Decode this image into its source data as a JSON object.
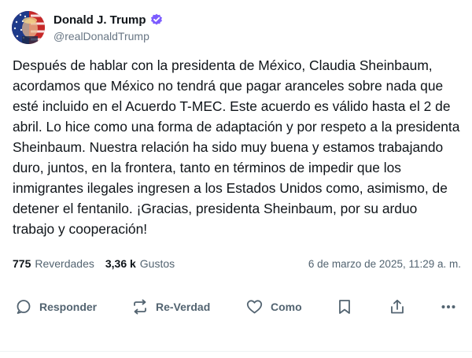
{
  "author": {
    "display_name": "Donald J. Trump",
    "handle": "@realDonaldTrump",
    "verified_badge": "verified-check-icon",
    "badge_color": "#7c5cff"
  },
  "post": {
    "text": "Después de hablar con la presidenta de México, Claudia Sheinbaum, acordamos que México no tendrá que pagar aranceles sobre nada que esté incluido en el Acuerdo T-MEC. Este acuerdo es válido hasta el 2 de abril. Lo hice como una forma de adaptación y por respeto a la presidenta Sheinbaum. Nuestra relación ha sido muy buena y estamos trabajando duro, juntos, en la frontera, tanto en términos de impedir que los inmigrantes ilegales ingresen a los Estados Unidos como, asimismo, de detener el fentanilo. ¡Gracias, presidenta Sheinbaum, por su arduo trabajo y cooperación!"
  },
  "stats": {
    "reposts_count": "775",
    "reposts_label": "Reverdades",
    "likes_count": "3,36 k",
    "likes_label": "Gustos",
    "timestamp": "6 de marzo de 2025, 11:29 a. m."
  },
  "actions": {
    "reply_label": "Responder",
    "repost_label": "Re-Verdad",
    "like_label": "Como",
    "icons": [
      "reply-icon",
      "repost-icon",
      "heart-icon",
      "bookmark-icon",
      "share-icon",
      "more-icon"
    ]
  }
}
